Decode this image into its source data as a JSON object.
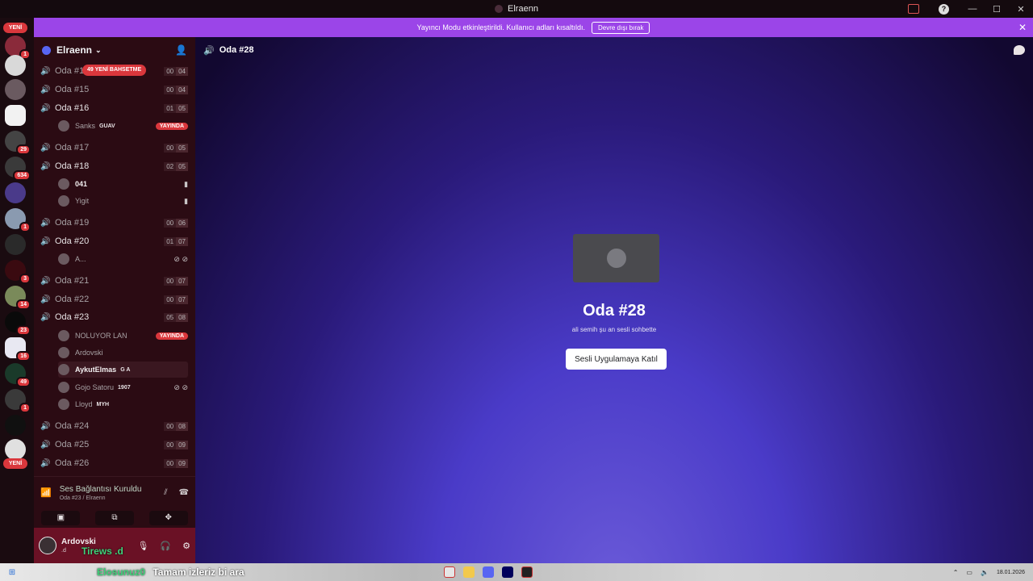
{
  "window": {
    "title": "Elraenn"
  },
  "notice": {
    "text": "Yayıncı Modu etkinleştirildi. Kullanıcı adları kısaltıldı.",
    "button": "Devre dışı bırak",
    "close": "✕"
  },
  "server_rail": {
    "yeni_top": "YENİ",
    "yeni_bottom": "YENİ",
    "badges": [
      "1",
      "29",
      "634",
      "1",
      "3",
      "14",
      "23",
      "16",
      "49",
      "1"
    ]
  },
  "guild": {
    "name": "Elraenn"
  },
  "mention_pill": "49 YENİ BAHSETME",
  "channels": [
    {
      "name": "Oda #14",
      "count": "00",
      "limit": "04"
    },
    {
      "name": "Oda #15",
      "count": "00",
      "limit": "04"
    },
    {
      "name": "Oda #16",
      "count": "01",
      "limit": "05"
    },
    {
      "name": "Oda #17",
      "count": "00",
      "limit": "05"
    },
    {
      "name": "Oda #18",
      "count": "02",
      "limit": "05"
    },
    {
      "name": "Oda #19",
      "count": "00",
      "limit": "06"
    },
    {
      "name": "Oda #20",
      "count": "01",
      "limit": "07"
    },
    {
      "name": "Oda #21",
      "count": "00",
      "limit": "07"
    },
    {
      "name": "Oda #22",
      "count": "00",
      "limit": "07"
    },
    {
      "name": "Oda #23",
      "count": "05",
      "limit": "08"
    },
    {
      "name": "Oda #24",
      "count": "00",
      "limit": "08"
    },
    {
      "name": "Oda #25",
      "count": "00",
      "limit": "09"
    },
    {
      "name": "Oda #26",
      "count": "00",
      "limit": "09"
    }
  ],
  "users": {
    "sanks": {
      "name": "Sanks",
      "tag": "GUAV",
      "live": "YAYINDA"
    },
    "u041": {
      "name": "041"
    },
    "yigit": {
      "name": "Yigit"
    },
    "a": {
      "name": "A..."
    },
    "noluyor": {
      "name": "NOLUYOR LAN",
      "live": "YAYINDA"
    },
    "ardovski": {
      "name": "Ardovski"
    },
    "aykut": {
      "name": "AykutElmas",
      "tag": "G A"
    },
    "gojo": {
      "name": "Gojo Satoru",
      "tag": "1907"
    },
    "lloyd": {
      "name": "Lloyd",
      "tag": "MYH"
    }
  },
  "voice_panel": {
    "title": "Ses Bağlantısı Kuruldu",
    "subtitle": "Oda #23 / Elraenn"
  },
  "user_panel": {
    "name": "Ardovski",
    "status": ".d"
  },
  "overlay": {
    "handle": "Tirews .d",
    "chat_user": "Elosunuz0",
    "chat_msg": "Tamam izleriz bi ara"
  },
  "main": {
    "header": "Oda #28",
    "title": "Oda #28",
    "subtitle": "ali semih şu an sesli sohbette",
    "join_button": "Sesli Uygulamaya Katıl"
  },
  "taskbar": {
    "date": "18.01.2026"
  },
  "colors": {
    "accent_notice": "#9b45e8",
    "live": "#da373c",
    "connected": "#4bb86a",
    "user_panel": "#6a1125"
  }
}
